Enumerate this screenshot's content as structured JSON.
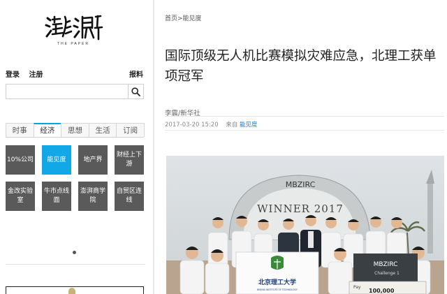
{
  "brand": {
    "logo_text": "澎湃",
    "logo_sub": "THE PAPER"
  },
  "auth": {
    "login": "登录",
    "register": "注册",
    "report": "报料"
  },
  "search": {
    "placeholder": "",
    "icon": "search-icon"
  },
  "tabs": [
    {
      "label": "时事"
    },
    {
      "label": "经济",
      "active": true
    },
    {
      "label": "思想"
    },
    {
      "label": "生活"
    },
    {
      "label": "订阅"
    }
  ],
  "channels": [
    {
      "label": "10%公司"
    },
    {
      "label": "能见度",
      "active": true
    },
    {
      "label": "地产界"
    },
    {
      "label": "财经上下游"
    },
    {
      "label": "金改实验室"
    },
    {
      "label": "牛市点线面"
    },
    {
      "label": "澎湃商学院"
    },
    {
      "label": "自贸区连线"
    }
  ],
  "article": {
    "breadcrumb": "首页>能见度",
    "title": "国际顶级无人机比赛模拟灾难应急，北理工获单项冠军",
    "author": "李震/新华社",
    "date": "2017-03-20 15:20",
    "source_prefix": "来自",
    "source": "能见度"
  },
  "photo": {
    "winner_text": "WINNER 2017",
    "dome_text": "MBZIRC",
    "banner_text": "北京理工大学",
    "banner_sub": "BEIJING INSTITUTE OF TECHNOLOGY",
    "sign_text": "MBZIRC",
    "sign_sub": "Challenge 1",
    "check_text": "Pay",
    "check_amount": "100,000"
  },
  "colors": {
    "accent": "#12a7e6",
    "tile": "#5a5a5a",
    "link": "#1a7fd0"
  }
}
